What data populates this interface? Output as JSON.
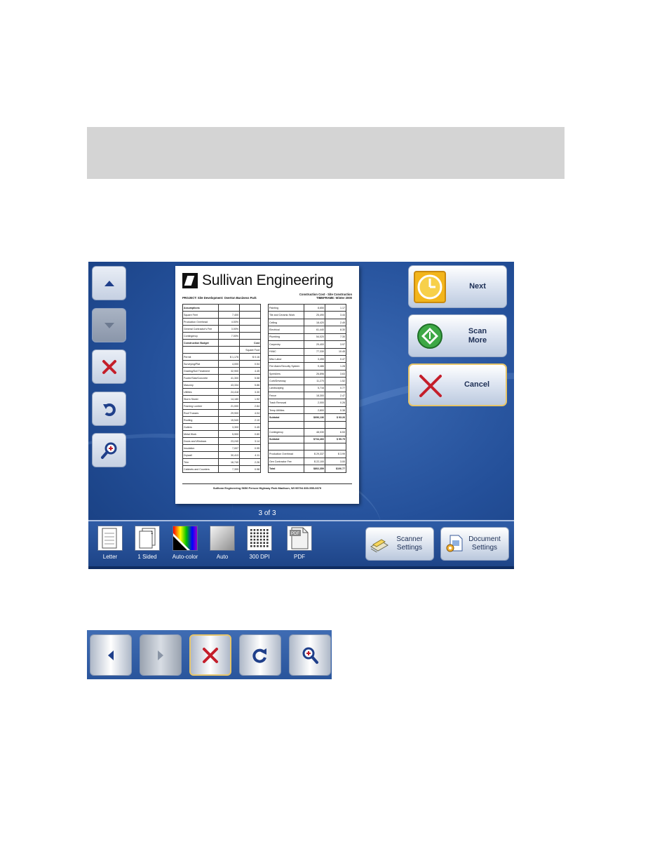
{
  "document": {
    "company": "Sullivan Engineering",
    "project": "PROJECT: Site Development: Overton Business Park",
    "estimate_title": "Construction Cost - Site Construction",
    "timeframe": "TIMEFRAME: Winter 2000",
    "left_rows": [
      [
        "Assumptions",
        "",
        ""
      ],
      [
        "Square Feet",
        "7,400",
        ""
      ],
      [
        "Production Overhead",
        "4.00%",
        ""
      ],
      [
        "General Contractor's Fee",
        "3.00%",
        ""
      ],
      [
        "Contingency",
        "7.00%",
        ""
      ],
      [
        "Construction Budget",
        "",
        "Cost"
      ],
      [
        "",
        "",
        "Square Foot"
      ],
      [
        "Permit",
        "$ 1,176",
        "$ 0.16"
      ],
      [
        "Surveying/Plat",
        "4,000",
        "0.54"
      ],
      [
        "Grading/Soil Treatment",
        "32,900",
        "4.45"
      ],
      [
        "Footer/Slab/Concrete",
        "41,300",
        "5.58"
      ],
      [
        "Masonry",
        "43,334",
        "5.86"
      ],
      [
        "Utilities",
        "24,418",
        "3.30"
      ],
      [
        "Storm Sewer",
        "14,180",
        "1.92"
      ],
      [
        "Framing Lumber",
        "21,000",
        "2.84"
      ],
      [
        "Roof Trusses",
        "29,900",
        "4.04"
      ],
      [
        "Roofing",
        "15,540",
        "2.10"
      ],
      [
        "Gutters",
        "3,300",
        "0.45"
      ],
      [
        "Metal Work",
        "5,900",
        "0.80"
      ],
      [
        "Doors and Windows",
        "23,240",
        "3.14"
      ],
      [
        "Insulation",
        "7,007",
        "0.95"
      ],
      [
        "Drywall",
        "30,413",
        "4.11"
      ],
      [
        "Trim",
        "16,740",
        "2.26"
      ],
      [
        "Cabinets and Counters",
        "7,399",
        "0.98"
      ]
    ],
    "right_rows": [
      [
        "Painting",
        "8,650",
        "1.17"
      ],
      [
        "Tile and Ceramic Work",
        "25,490",
        "3.44"
      ],
      [
        "Ceiling",
        "18,420",
        "2.49"
      ],
      [
        "Electrical",
        "61,440",
        "8.30"
      ],
      [
        "Plumbing",
        "54,020",
        "7.30"
      ],
      [
        "Carpentry",
        "29,400",
        "3.97"
      ],
      [
        "HVAC",
        "77,330",
        "10.45"
      ],
      [
        "Misc Labor",
        "3,455",
        "0.47"
      ],
      [
        "Fire Alarm/Security System",
        "9,486",
        "1.28"
      ],
      [
        "Sprinklers",
        "26,896",
        "3.63"
      ],
      [
        "Curb/Driveway",
        "11,270",
        "1.52"
      ],
      [
        "Landscaping",
        "5,716",
        "0.77"
      ],
      [
        "Fence",
        "18,300",
        "2.47"
      ],
      [
        "Trash Removal",
        "2,000",
        "0.26"
      ],
      [
        "Temp Utilities",
        "2,800",
        "0.38"
      ],
      [
        "Subtotal",
        "$696,136",
        "$ 93.26"
      ],
      [
        "",
        "",
        ""
      ],
      [
        "Contingency",
        "48,030",
        "6.53"
      ],
      [
        "Subtotal",
        "$734,466",
        "$ 99.79"
      ],
      [
        "",
        "",
        ""
      ],
      [
        "Production Overhead",
        "$ 29,337",
        "$ 3.99"
      ],
      [
        "Gen Contractor Fee",
        "$ 22,100",
        "3.00"
      ],
      [
        "Total",
        "$802,359",
        "$106.77"
      ]
    ],
    "footer": "Sullivan Engineering   5656 Person Highway Park   Madison, WI 99794   800-555-0679"
  },
  "page_counter": "3 of 3",
  "actions": {
    "next": "Next",
    "scan_more_1": "Scan",
    "scan_more_2": "More",
    "cancel": "Cancel"
  },
  "settings": [
    {
      "label": "Letter",
      "icon": "letter-page-icon"
    },
    {
      "label": "1 Sided",
      "icon": "one-sided-icon"
    },
    {
      "label": "Auto-color",
      "icon": "auto-color-icon"
    },
    {
      "label": "Auto",
      "icon": "auto-brightness-icon"
    },
    {
      "label": "300 DPI",
      "icon": "resolution-grid-icon"
    },
    {
      "label": "PDF",
      "icon": "pdf-file-icon"
    }
  ],
  "scanner_settings": {
    "line1": "Scanner",
    "line2": "Settings"
  },
  "document_settings": {
    "line1": "Document",
    "line2": "Settings"
  },
  "colors": {
    "panel_blue": "#24509a",
    "bar_blue": "#1d4386",
    "label_navy": "#1d2f55",
    "selected_gold": "#e6c56a",
    "cancel_red": "#c41e2a"
  }
}
